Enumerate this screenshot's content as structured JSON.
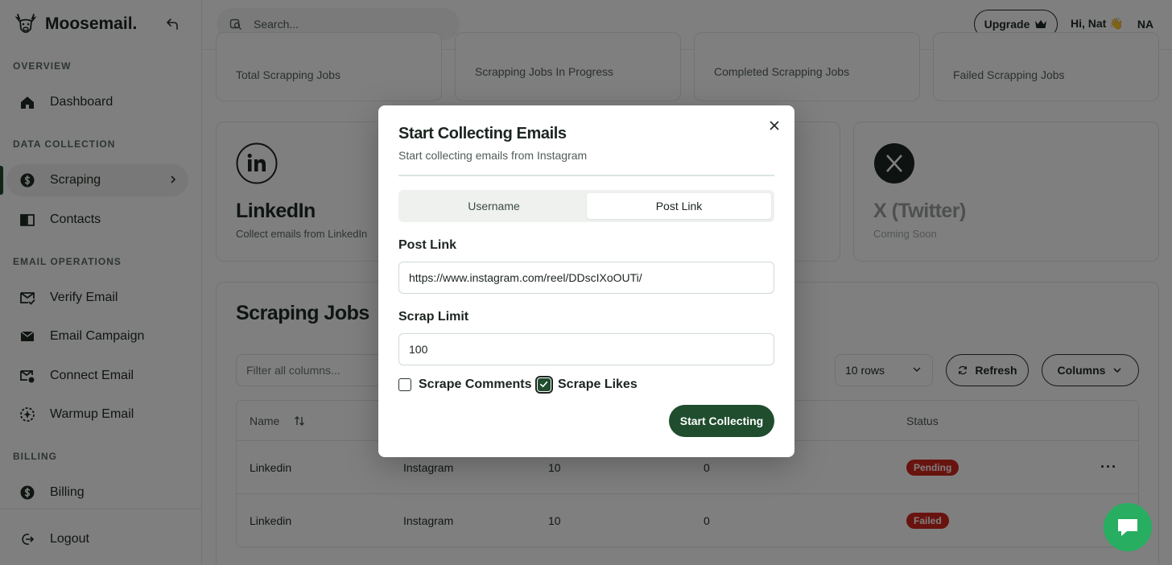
{
  "app": {
    "name": "Moosemail."
  },
  "sidebar": {
    "sections": [
      {
        "label": "OVERVIEW"
      },
      {
        "label": "DATA COLLECTION"
      },
      {
        "label": "EMAIL OPERATIONS"
      },
      {
        "label": "BILLING"
      }
    ],
    "items": [
      {
        "label": "Dashboard",
        "icon": "home-icon"
      },
      {
        "label": "Scraping",
        "icon": "scraping-icon",
        "active": true
      },
      {
        "label": "Contacts",
        "icon": "contacts-icon"
      },
      {
        "label": "Verify Email",
        "icon": "verify-email-icon"
      },
      {
        "label": "Email Campaign",
        "icon": "mail-icon"
      },
      {
        "label": "Connect Email",
        "icon": "connect-email-icon"
      },
      {
        "label": "Warmup Email",
        "icon": "warmup-icon"
      },
      {
        "label": "Billing",
        "icon": "dollar-icon"
      }
    ],
    "logout_label": "Logout"
  },
  "topbar": {
    "search_placeholder": "Search...",
    "upgrade_label": "Upgrade",
    "greeting": "Hi, Nat 👋",
    "avatar_initials": "NA"
  },
  "stats": [
    {
      "label": "Total Scrapping Jobs"
    },
    {
      "label": "Scrapping Jobs In Progress"
    },
    {
      "label": "Completed Scrapping Jobs"
    },
    {
      "label": "Failed Scrapping Jobs"
    }
  ],
  "sources": [
    {
      "title": "LinkedIn",
      "desc": "Collect emails from LinkedIn"
    },
    {
      "title": "X (Twitter)",
      "desc": "Coming Soon"
    }
  ],
  "jobs": {
    "title": "Scraping Jobs",
    "filter_placeholder": "Filter all columns...",
    "rows_select": "10 rows",
    "refresh_label": "Refresh",
    "columns_label": "Columns",
    "headers": {
      "name": "Name",
      "status": "Status"
    },
    "rows": [
      {
        "name": "Linkedin",
        "source": "Instagram",
        "limit": "10",
        "found": "0",
        "status": "Pending"
      },
      {
        "name": "Linkedin",
        "source": "Instagram",
        "limit": "10",
        "found": "0",
        "status": "Failed"
      }
    ]
  },
  "modal": {
    "title": "Start Collecting Emails",
    "subtitle": "Start collecting emails from Instagram",
    "tabs": [
      {
        "label": "Username"
      },
      {
        "label": "Post Link",
        "active": true
      }
    ],
    "post_link_label": "Post Link",
    "post_link_value": "https://www.instagram.com/reel/DDscIXoOUTi/",
    "scrap_limit_label": "Scrap Limit",
    "scrap_limit_value": "100",
    "scrape_comments_label": "Scrape Comments",
    "scrape_comments_checked": false,
    "scrape_likes_label": "Scrape Likes",
    "scrape_likes_checked": true,
    "submit_label": "Start Collecting"
  },
  "colors": {
    "primary": "#1f4d2e",
    "danger": "#d3261e",
    "chat": "#27ae60"
  }
}
